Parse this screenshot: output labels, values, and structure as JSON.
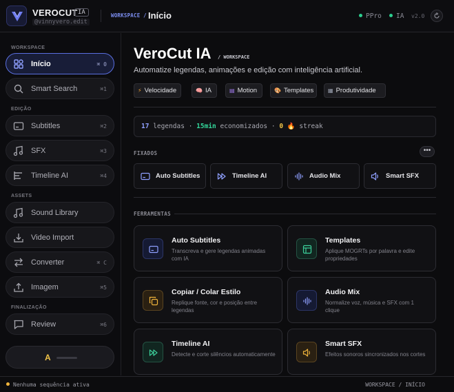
{
  "header": {
    "brand": "VEROCUT",
    "brand_badge": "IA",
    "brand_sub": "@vinnyvero.edit",
    "crumb_workspace": "WORKSPACE",
    "crumb_sep": "/",
    "crumb_page": "Início",
    "status_ppro": "PPro",
    "status_ia": "IA",
    "version": "v2.0",
    "refresh_icon": "refresh-icon"
  },
  "sidebar": {
    "sections": {
      "workspace": "WORKSPACE",
      "edicao": "EDIÇÃO",
      "assets": "ASSETS",
      "finalizacao": "FINALIZAÇÃO"
    },
    "items": [
      {
        "label": "Início",
        "shortcut": "⌘ 0",
        "icon": "home-grid-icon"
      },
      {
        "label": "Smart Search",
        "shortcut": "⌘1",
        "icon": "search-icon"
      },
      {
        "label": "Subtitles",
        "shortcut": "⌘2",
        "icon": "subtitles-icon"
      },
      {
        "label": "SFX",
        "shortcut": "⌘3",
        "icon": "music-note-icon"
      },
      {
        "label": "Timeline AI",
        "shortcut": "⌘4",
        "icon": "timeline-icon"
      },
      {
        "label": "Sound Library",
        "shortcut": "",
        "icon": "music-note-icon"
      },
      {
        "label": "Video Import",
        "shortcut": "",
        "icon": "download-icon"
      },
      {
        "label": "Converter",
        "shortcut": "⌘ C",
        "icon": "swap-icon"
      },
      {
        "label": "Imagem",
        "shortcut": "⌘5",
        "icon": "upload-icon"
      },
      {
        "label": "Review",
        "shortcut": "⌘6",
        "icon": "chat-icon"
      }
    ],
    "bottom_letter": "A"
  },
  "main": {
    "title": "VeroCut IA",
    "title_suffix": "/ WORKSPACE",
    "subtitle": "Automatize legendas, animações e edição com inteligência artificial.",
    "chips": [
      {
        "icon": "⚡",
        "label": "Velocidade",
        "color": "#f0a030"
      },
      {
        "icon": "🧠",
        "label": "IA",
        "color": "#e86aa8"
      },
      {
        "icon": "▤",
        "label": "Motion",
        "color": "#a37cf0"
      },
      {
        "icon": "🎨",
        "label": "Templates",
        "color": "#e8a060"
      },
      {
        "icon": "▦",
        "label": "Produtividade",
        "color": "#9aa0b0"
      }
    ],
    "stats": {
      "count": "17",
      "count_label": "legendas",
      "sep": "·",
      "time": "15min",
      "time_label": "economizados",
      "streak": "0",
      "streak_icon": "🔥",
      "streak_label": "streak"
    },
    "pinned_label": "FIXADOS",
    "more_label": "•••",
    "pinned": [
      {
        "label": "Auto Subtitles",
        "icon": "subtitles-icon"
      },
      {
        "label": "Timeline AI",
        "icon": "fast-forward-icon"
      },
      {
        "label": "Audio Mix",
        "icon": "waveform-icon"
      },
      {
        "label": "Smart SFX",
        "icon": "speaker-icon"
      }
    ],
    "tools_label": "FERRAMENTAS",
    "tools": [
      {
        "title": "Auto Subtitles",
        "desc": "Transcreva e gere legendas animadas com IA",
        "icon": "subtitles-icon",
        "accent": "#6f86ff"
      },
      {
        "title": "Templates",
        "desc": "Aplique MOGRTs por palavra e edite propriedades",
        "icon": "layout-icon",
        "accent": "#3ccf9a"
      },
      {
        "title": "Copiar / Colar Estilo",
        "desc": "Replique fonte, cor e posição entre legendas",
        "icon": "copy-icon",
        "accent": "#f0b43c"
      },
      {
        "title": "Audio Mix",
        "desc": "Normalize voz, música e SFX com 1 clique",
        "icon": "waveform-icon",
        "accent": "#6f86ff"
      },
      {
        "title": "Timeline AI",
        "desc": "Detecte e corte silêncios automaticamente",
        "icon": "fast-forward-icon",
        "accent": "#3ccf9a"
      },
      {
        "title": "Smart SFX",
        "desc": "Efeitos sonoros sincronizados nos cortes",
        "icon": "speaker-icon",
        "accent": "#f0b43c"
      }
    ]
  },
  "footer": {
    "left": "Nenhuma sequência ativa",
    "right": "WORKSPACE / INÍCIO"
  }
}
